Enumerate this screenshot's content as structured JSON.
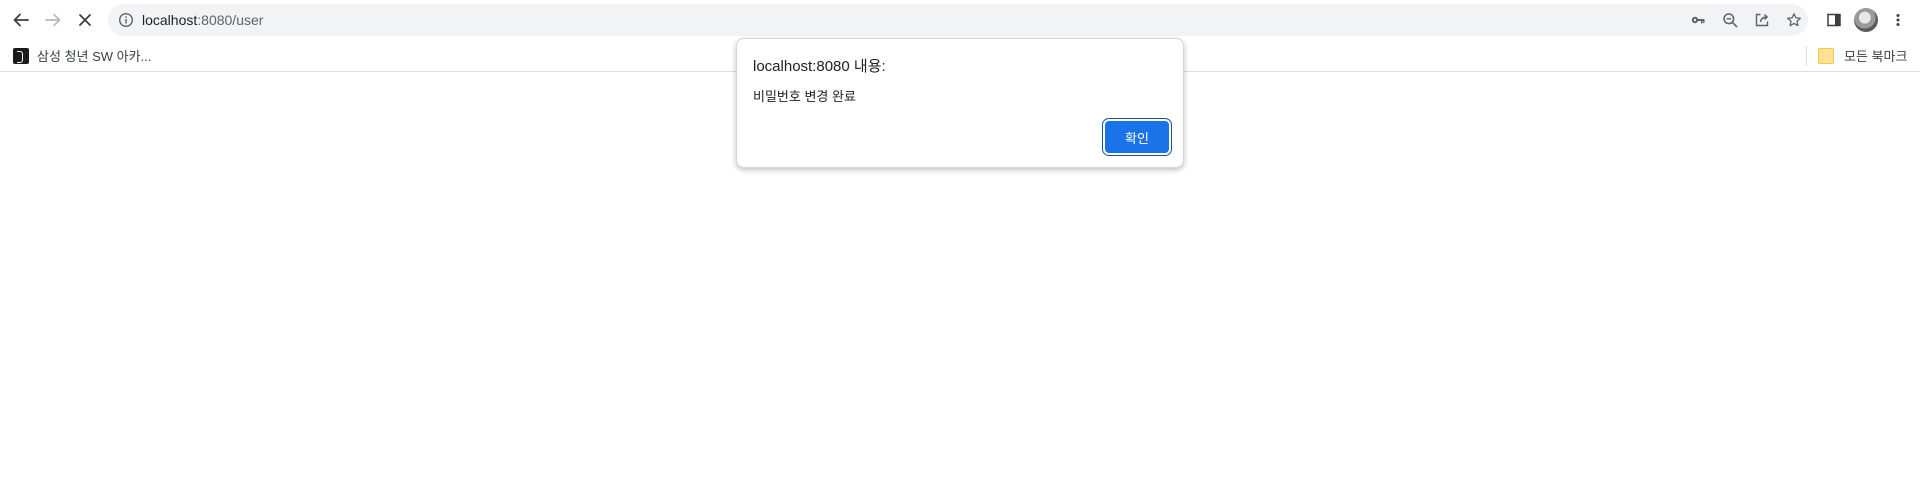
{
  "browser": {
    "url_host": "localhost",
    "url_rest": ":8080/user",
    "colors": {
      "accent": "#1a73e8",
      "omnibox_bg": "#f1f3f4"
    },
    "icons": {
      "back": "back-arrow-icon",
      "forward": "forward-arrow-icon",
      "stop": "stop-loading-icon",
      "site_info": "info-icon",
      "password": "key-icon",
      "zoom": "zoom-icon",
      "share": "share-icon",
      "bookmark": "star-icon",
      "side_panel": "side-panel-icon",
      "profile": "avatar",
      "menu": "kebab-menu-icon"
    }
  },
  "bookmarks": {
    "items": [
      {
        "label": "삼성 청년 SW 아카..."
      }
    ],
    "all_bookmarks_label": "모든 북마크"
  },
  "dialog": {
    "title": "localhost:8080 내용:",
    "message": "비밀번호 변경 완료",
    "ok_label": "확인"
  }
}
